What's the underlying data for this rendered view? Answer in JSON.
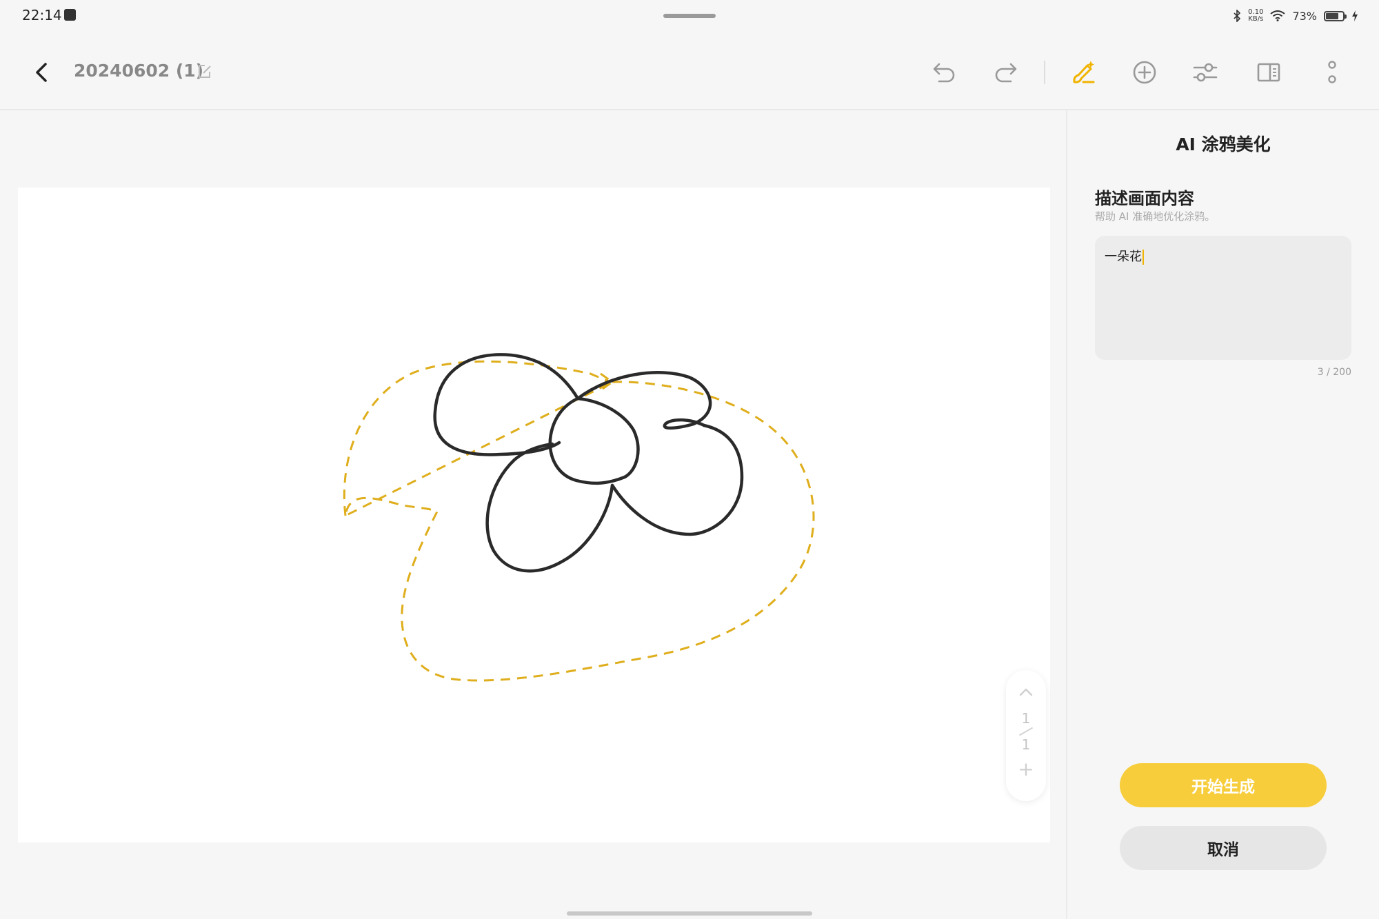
{
  "status_bar": {
    "time": "22:14",
    "net_speed_value": "0.10",
    "net_speed_unit": "KB/s",
    "battery": "73%",
    "battery_level": 0.73
  },
  "toolbar": {
    "doc_title": "20240602 (1)",
    "icons": [
      "back-icon",
      "edit-icon",
      "undo-icon",
      "redo-icon",
      "ai-brush-icon",
      "add-icon",
      "adjust-icon",
      "panel-icon",
      "more-icon"
    ],
    "accent_color": "#f0b400"
  },
  "page_nav": {
    "current_page": "1",
    "total_pages": "1"
  },
  "panel": {
    "title": "AI 涂鸦美化",
    "section_heading": "描述画面内容",
    "section_hint": "帮助 AI 准确地优化涂鸦。",
    "prompt_value": "一朵花",
    "char_count": "3 / 200",
    "generate_label": "开始生成",
    "cancel_label": "取消",
    "generate_color": "#f7cd3c"
  }
}
